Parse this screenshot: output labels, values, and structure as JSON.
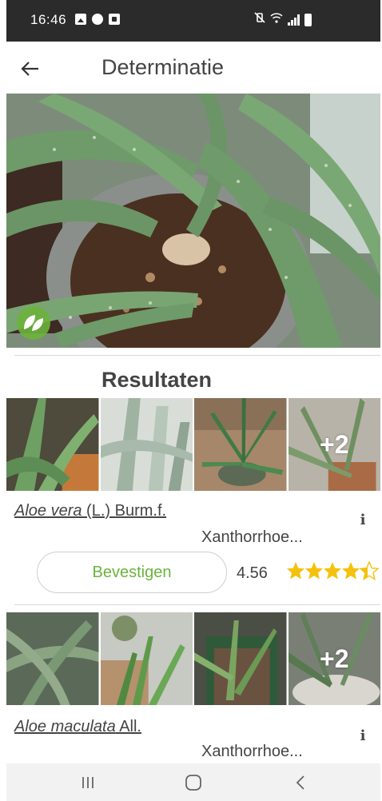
{
  "status_bar": {
    "time": "16:46",
    "left_icons": [
      "image-icon",
      "spotify-icon",
      "square-app-icon"
    ],
    "right_icons": [
      "mute-vibrate-icon",
      "wifi-icon",
      "signal-icon",
      "battery-icon"
    ]
  },
  "app_bar": {
    "title": "Determinatie",
    "back_icon": "arrow-left-icon"
  },
  "hero": {
    "badge_icon": "leaf-icon",
    "colors": {
      "leaf": "#6f9a6a",
      "soil": "#4a3020",
      "pot": "#8a8f8c"
    }
  },
  "results": {
    "heading": "Resultaten",
    "items": [
      {
        "genus_species": "Aloe vera",
        "authority": " (L.) Burm.f.",
        "family": "Xanthorrhoe...",
        "more_count": "+2",
        "confirm_label": "Bevestigen",
        "score": "4.56",
        "rating": 4.56
      },
      {
        "genus_species": "Aloe maculata",
        "authority": " All.",
        "family": "Xanthorrhoe...",
        "more_count": "+2"
      }
    ]
  },
  "nav_bar": {
    "icons": [
      "recent-apps-icon",
      "home-icon",
      "back-icon"
    ]
  },
  "colors": {
    "accent_green": "#6bb33b",
    "star_gold": "#f4c20d",
    "status_bar": "#2b2b2b",
    "nav_bar": "#f2f2f2"
  }
}
